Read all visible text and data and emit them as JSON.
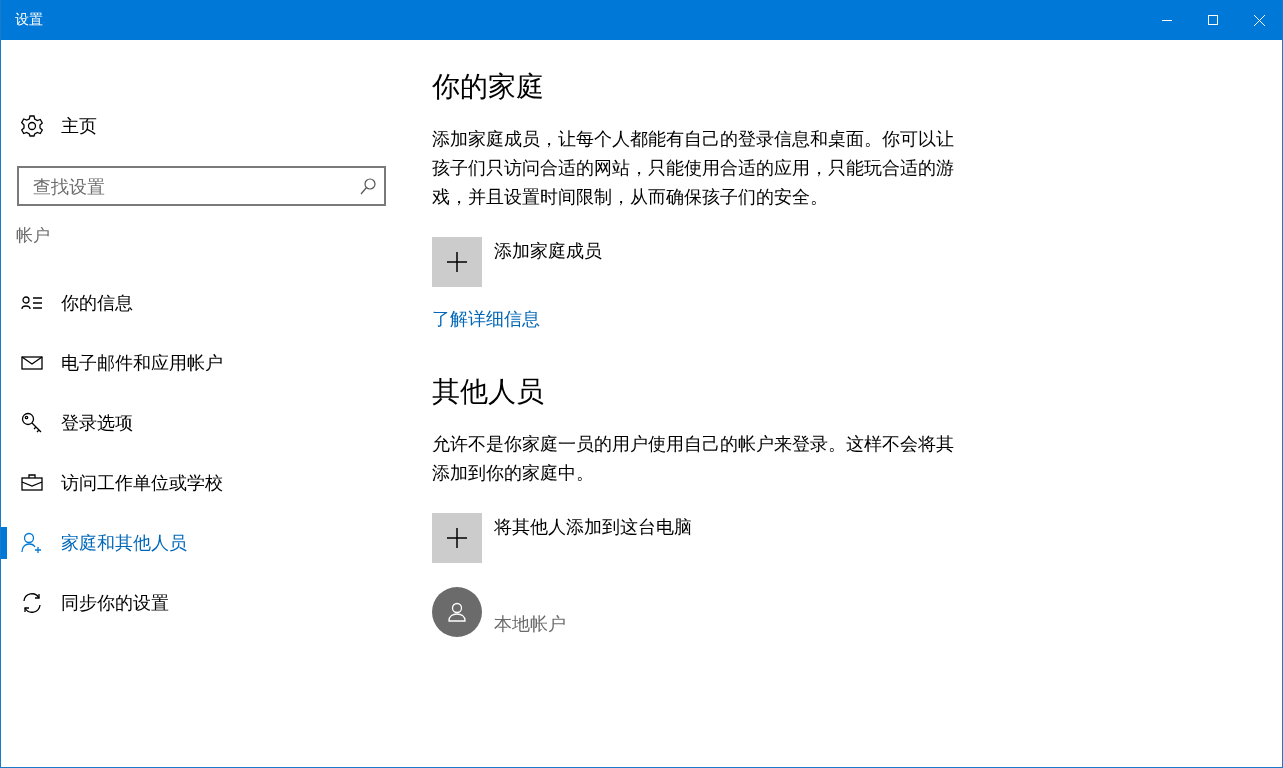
{
  "window": {
    "title": "设置"
  },
  "sidebar": {
    "home": "主页",
    "search": {
      "placeholder": "查找设置"
    },
    "section": "帐户",
    "items": [
      {
        "label": "你的信息",
        "kind": "info",
        "selected": false
      },
      {
        "label": "电子邮件和应用帐户",
        "kind": "mail",
        "selected": false
      },
      {
        "label": "登录选项",
        "kind": "key",
        "selected": false
      },
      {
        "label": "访问工作单位或学校",
        "kind": "briefcase",
        "selected": false
      },
      {
        "label": "家庭和其他人员",
        "kind": "family",
        "selected": true
      },
      {
        "label": "同步你的设置",
        "kind": "sync",
        "selected": false
      }
    ]
  },
  "family": {
    "heading": "你的家庭",
    "description": "添加家庭成员，让每个人都能有自己的登录信息和桌面。你可以让孩子们只访问合适的网站，只能使用合适的应用，只能玩合适的游戏，并且设置时间限制，从而确保孩子们的安全。",
    "add": "添加家庭成员",
    "link": "了解详细信息"
  },
  "others": {
    "heading": "其他人员",
    "description": "允许不是你家庭一员的用户使用自己的帐户来登录。这样不会将其添加到你的家庭中。",
    "add": "将其他人添加到这台电脑",
    "accounts": [
      {
        "name": "本地帐户"
      }
    ]
  }
}
